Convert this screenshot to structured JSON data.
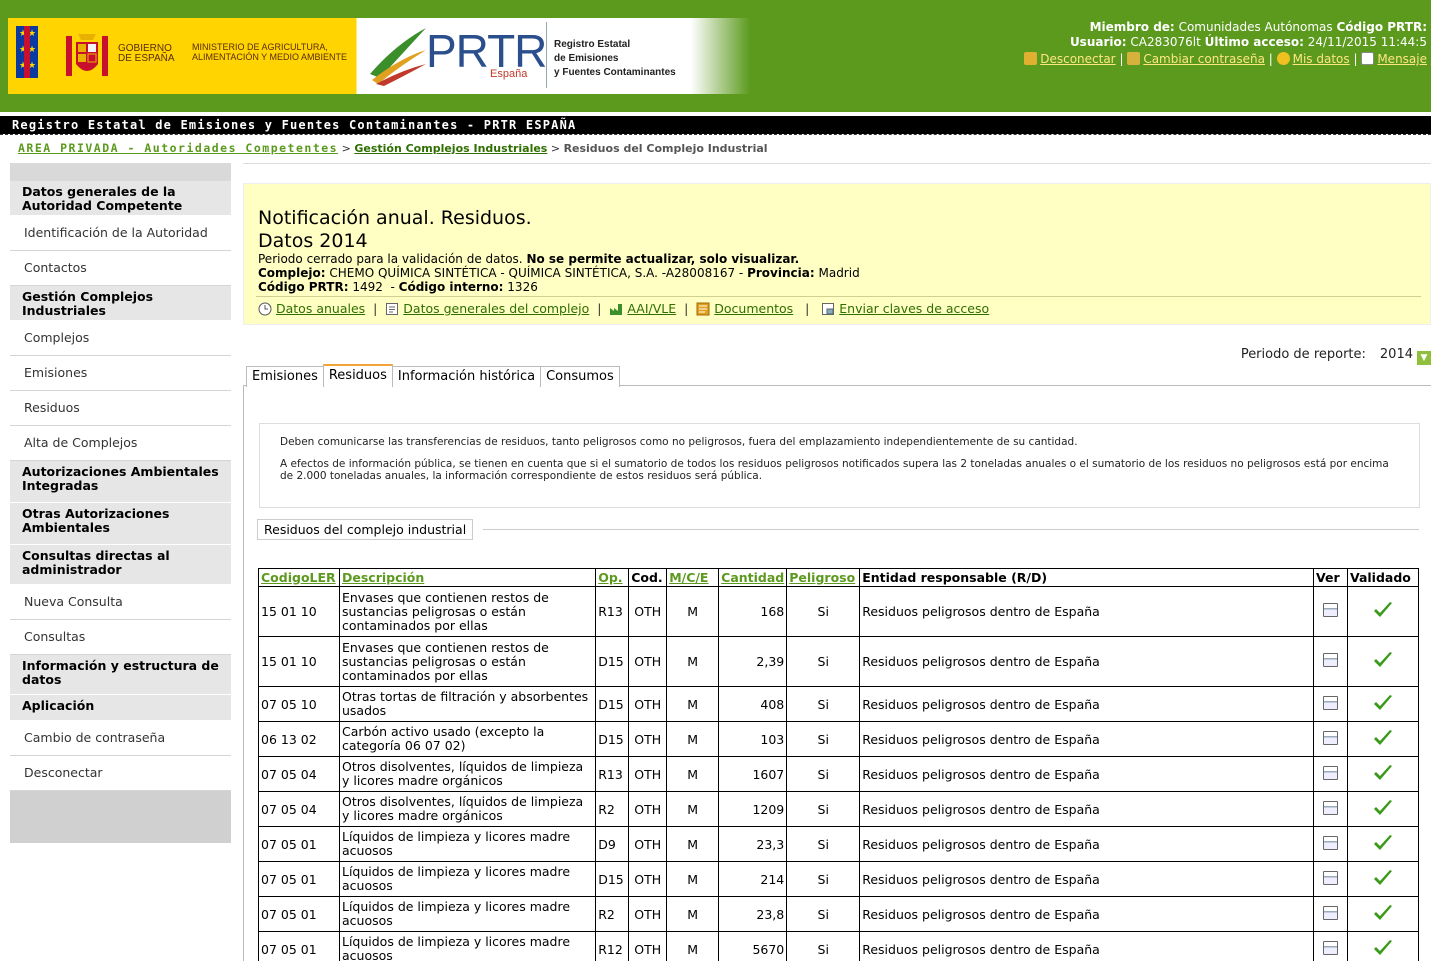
{
  "header": {
    "gov_name": "Gobierno de España",
    "ministry": "Ministerio de Agricultura, Alimentación y Medio Ambiente",
    "prtr_logo": "PRTR",
    "prtr_country": "España",
    "registry_line1": "Registro Estatal",
    "registry_line2": "de Emisiones",
    "registry_line3": "y Fuentes Contaminantes",
    "member_label": "Miembro de:",
    "member_value": "Comunidades Autónomas",
    "prtr_code_label": "Código PRTR:",
    "prtr_code_value": "",
    "user_label": "Usuario:",
    "user_value": "CA283076lt",
    "last_access_label": "Último acceso:",
    "last_access_value": "24/11/2015 11:44:5",
    "links": {
      "disconnect": "Desconectar",
      "change_password": "Cambiar contraseña",
      "my_data": "Mis datos",
      "messages": "Mensaje"
    }
  },
  "title_bar": "Registro Estatal de Emisiones y Fuentes Contaminantes - PRTR ESPAÑA",
  "breadcrumb": {
    "item1": "AREA PRIVADA - Autoridades Competentes",
    "sep": " > ",
    "item2": "Gestión Complejos Industriales",
    "item3": "Residuos del Complejo Industrial"
  },
  "sidebar": {
    "sections": [
      {
        "title": "Datos generales de la Autoridad Competente",
        "items": [
          "Identificación de la Autoridad",
          "Contactos"
        ]
      },
      {
        "title": "Gestión Complejos Industriales",
        "items": [
          "Complejos",
          "Emisiones",
          "Residuos",
          "Alta de Complejos"
        ]
      },
      {
        "title": "Autorizaciones Ambientales Integradas",
        "items": []
      },
      {
        "title": "Otras Autorizaciones Ambientales",
        "items": []
      },
      {
        "title": "Consultas directas al administrador",
        "items": [
          "Nueva Consulta",
          "Consultas"
        ]
      },
      {
        "title": "Información y estructura de datos",
        "items": []
      },
      {
        "title": "Aplicación",
        "items": [
          "Cambio de contraseña",
          "Desconectar"
        ]
      }
    ]
  },
  "notification": {
    "title": "Notificación anual. Residuos.",
    "year": "Datos 2014",
    "period_text": "Periodo cerrado para la validación de datos.",
    "period_bold": "No se permite actualizar, solo visualizar.",
    "complex_label": "Complejo:",
    "complex_value": "CHEMO QUÍMICA SINTÉTICA - QUÍMICA SINTÉTICA, S.A. -A28008167 -",
    "province_label": "Provincia:",
    "province_value": "Madrid",
    "prtr_code_label": "Código PRTR:",
    "prtr_code_value": "1492",
    "internal_code_label": "Código interno:",
    "internal_code_value": "1326",
    "links": {
      "annual": "Datos anuales",
      "general": "Datos generales del complejo",
      "aai": "AAI/VLE",
      "docs": "Documentos",
      "keys": "Enviar claves de acceso"
    }
  },
  "period": {
    "label": "Periodo de reporte:",
    "value": "2014"
  },
  "tabs": [
    "Emisiones",
    "Residuos",
    "Información histórica",
    "Consumos"
  ],
  "info": {
    "p1": "Deben comunicarse las transferencias de residuos, tanto peligrosos como no peligrosos, fuera del emplazamiento independientemente de su cantidad.",
    "p2": "A efectos de información pública, se tienen en cuenta que si el sumatorio de todos los residuos peligrosos notificados supera las 2 toneladas anuales o el sumatorio de los residuos no peligrosos está por encima de 2.000 toneladas anuales, la información correspondiente de estos residuos será pública."
  },
  "section_title": "Residuos del complejo industrial",
  "table": {
    "headers": [
      "CodigoLER",
      "Descripción",
      "Op.",
      "Cod.",
      "M/C/E",
      "Cantidad",
      "Peligroso",
      "Entidad responsable (R/D)",
      "Ver",
      "Validado"
    ],
    "rows": [
      [
        "15 01 10",
        "Envases que contienen restos de sustancias peligrosas o están contaminados por ellas",
        "R13",
        "OTH",
        "M",
        "168",
        "Si",
        "Residuos peligrosos dentro de España"
      ],
      [
        "15 01 10",
        "Envases que contienen restos de sustancias peligrosas o están contaminados por ellas",
        "D15",
        "OTH",
        "M",
        "2,39",
        "Si",
        "Residuos peligrosos dentro de España"
      ],
      [
        "07 05 10",
        "Otras tortas de filtración y absorbentes usados",
        "D15",
        "OTH",
        "M",
        "408",
        "Si",
        "Residuos peligrosos dentro de España"
      ],
      [
        "06 13 02",
        "Carbón activo usado (excepto la categoría 06 07 02)",
        "D15",
        "OTH",
        "M",
        "103",
        "Si",
        "Residuos peligrosos dentro de España"
      ],
      [
        "07 05 04",
        "Otros disolventes, líquidos de limpieza y licores madre orgánicos",
        "R13",
        "OTH",
        "M",
        "1607",
        "Si",
        "Residuos peligrosos dentro de España"
      ],
      [
        "07 05 04",
        "Otros disolventes, líquidos de limpieza y licores madre orgánicos",
        "R2",
        "OTH",
        "M",
        "1209",
        "Si",
        "Residuos peligrosos dentro de España"
      ],
      [
        "07 05 01",
        "Líquidos de limpieza y licores madre acuosos",
        "D9",
        "OTH",
        "M",
        "23,3",
        "Si",
        "Residuos peligrosos dentro de España"
      ],
      [
        "07 05 01",
        "Líquidos de limpieza y licores madre acuosos",
        "D15",
        "OTH",
        "M",
        "214",
        "Si",
        "Residuos peligrosos dentro de España"
      ],
      [
        "07 05 01",
        "Líquidos de limpieza y licores madre acuosos",
        "R2",
        "OTH",
        "M",
        "23,8",
        "Si",
        "Residuos peligrosos dentro de España"
      ],
      [
        "07 05 01",
        "Líquidos de limpieza y licores madre acuosos",
        "R12",
        "OTH",
        "M",
        "5670",
        "Si",
        "Residuos peligrosos dentro de España"
      ]
    ]
  },
  "colors": {
    "header_green": "#5c9a1e",
    "notif_yellow": "#ffffc4",
    "link_green": "#2f6e00",
    "check_green": "#3a9a1a"
  }
}
